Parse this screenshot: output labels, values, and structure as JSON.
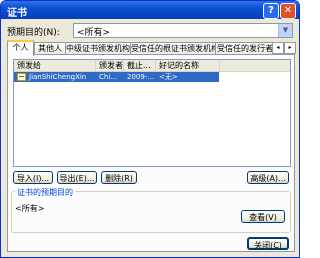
{
  "window": {
    "title": "证书",
    "help": "?",
    "close": "✕"
  },
  "purpose": {
    "label": "预期目的(N):",
    "value": "<所有>"
  },
  "tabs": [
    "个人",
    "其他人",
    "中级证书颁发机构",
    "受信任的根证书颁发机构",
    "受信任的发行者"
  ],
  "tab_scroll": {
    "left": "◂",
    "right": "▸"
  },
  "table": {
    "columns": [
      "颁发给",
      "颁发者",
      "截止...",
      "好记的名称"
    ],
    "rows": [
      {
        "issued_to": "JianShiChengXin",
        "issuer": "Chi...",
        "expires": "2009-...",
        "friendly_name": "<无>"
      }
    ]
  },
  "buttons": {
    "import": "导入(I)...",
    "export": "导出(E)...",
    "remove": "删除(R)",
    "advanced": "高级(A)...",
    "view": "查看(V)",
    "close": "关闭(C)"
  },
  "intended": {
    "label": "证书的预期目的",
    "value": "<所有>"
  },
  "colors": {
    "titlebar": "#0a50d0",
    "selection": "#316ac5",
    "tab_highlight": "#ffc83c",
    "group_label": "#0046d5"
  },
  "icons": [
    "help-icon",
    "close-icon",
    "chevron-down-icon",
    "certificate-icon"
  ]
}
